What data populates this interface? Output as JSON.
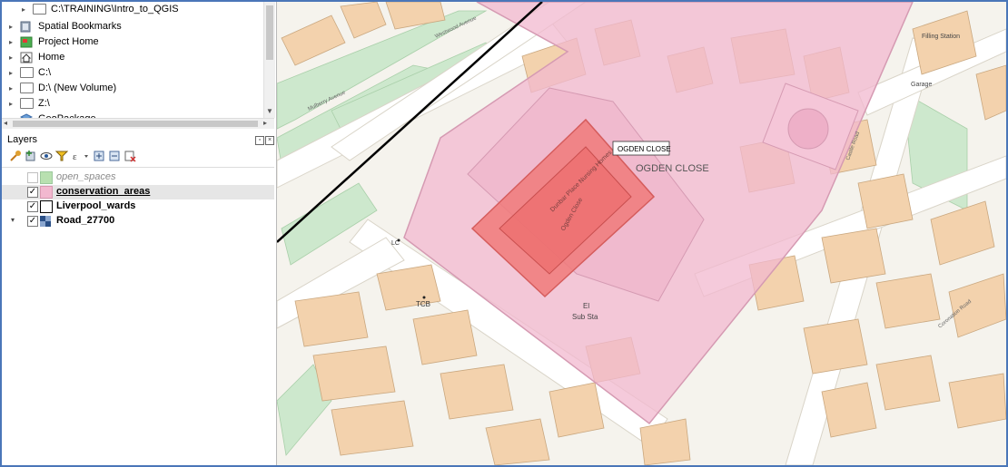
{
  "browser": {
    "items": [
      {
        "label": "C:\\TRAINING\\Intro_to_QGIS",
        "icon": "folder-icon"
      },
      {
        "label": "Spatial Bookmarks",
        "icon": "bookmarks-icon"
      },
      {
        "label": "Project Home",
        "icon": "project-home-icon"
      },
      {
        "label": "Home",
        "icon": "home-icon"
      },
      {
        "label": "C:\\",
        "icon": "folder-icon"
      },
      {
        "label": "D:\\ (New Volume)",
        "icon": "folder-icon"
      },
      {
        "label": "Z:\\",
        "icon": "folder-icon"
      },
      {
        "label": "GeoPackage",
        "icon": "geopackage-icon"
      }
    ]
  },
  "layers_panel": {
    "title": "Layers",
    "toolbar": [
      "style-brush-icon",
      "add-layer-icon",
      "visibility-eye-icon",
      "filter-icon",
      "expression-filter-icon",
      "expand-all-icon",
      "collapse-all-icon",
      "remove-layer-icon"
    ],
    "layers": [
      {
        "name": "open_spaces",
        "checked": false,
        "symbol_color": "#b8e0b0",
        "expandable": false,
        "selected": false
      },
      {
        "name": "conservation_areas",
        "checked": true,
        "symbol_color": "#f2b8cf",
        "expandable": false,
        "selected": true
      },
      {
        "name": "Liverpool_wards",
        "checked": true,
        "symbol_color": "#ffffff",
        "expandable": false,
        "selected": false
      },
      {
        "name": "Road_27700",
        "checked": true,
        "symbol_color": "#2a4f86",
        "expandable": true,
        "selected": false
      }
    ]
  },
  "map": {
    "tooltip": "OGDEN CLOSE",
    "labels": {
      "area_name": "OGDEN CLOSE",
      "street_ogden": "Ogden Close",
      "building_name": "Dunbar Place Nursing Homes",
      "substation_el": "El",
      "substation_sub": "Sub Sta",
      "tcb": "TCB",
      "lc": "LC",
      "filling_station": "Filling Station",
      "garage": "Garage",
      "road_a": "Mulberry Avenue",
      "road_b": "Westwood Avenue",
      "road_c": "Coronation Road",
      "road_d": "Castle Road"
    },
    "colors": {
      "background": "#f5f3ed",
      "building": "#f3d2ad",
      "building_stroke": "#c9a77f",
      "road": "#ffffff",
      "green": "#cde8cd",
      "conservation_fill": "#f2b8cf",
      "ward_fill": "#f08080",
      "boundary_line": "#000000"
    }
  }
}
